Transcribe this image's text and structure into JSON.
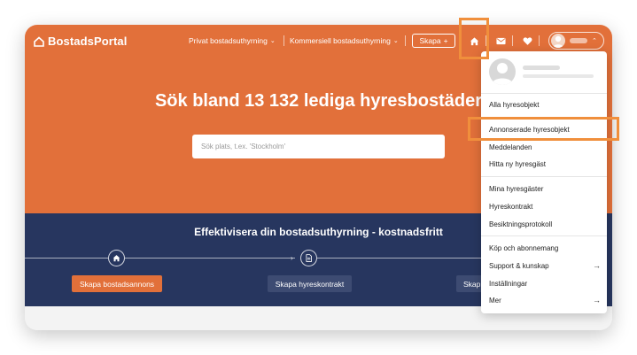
{
  "brand": {
    "name": "BostadsPortal"
  },
  "nav": {
    "privat": "Privat bostadsuthyrning",
    "kommersiell": "Kommersiell bostadsuthyrning",
    "skapa": "Skapa",
    "skapa_plus": "+"
  },
  "hero": {
    "headline": "Sök bland 13 132 lediga hyresbostäder",
    "search_placeholder": "Sök plats, t.ex. 'Stockholm'"
  },
  "band": {
    "title": "Effektivisera din bostadsuthyrning - kostnadsfritt",
    "steps": [
      {
        "icon": "house-icon",
        "label": "Skapa bostadsannons"
      },
      {
        "icon": "document-icon",
        "label": "Skapa hyreskontrakt"
      },
      {
        "label": "Skap"
      }
    ]
  },
  "dropdown": {
    "groups": [
      [
        "Alla hyresobjekt"
      ],
      [
        "Annonserade hyresobjekt",
        "Meddelanden",
        "Hitta ny hyresgäst"
      ],
      [
        "Mina hyresgäster",
        "Hyreskontrakt",
        "Besiktningsprotokoll"
      ],
      [
        "Köp och abonnemang",
        "Support & kunskap",
        "Inställningar",
        "Mer"
      ]
    ],
    "items_with_arrow": [
      "Support & kunskap",
      "Mer"
    ],
    "arrow": "→"
  },
  "colors": {
    "brand_orange": "#e2703a",
    "navy": "#27365f",
    "highlight": "#f08f3c"
  }
}
